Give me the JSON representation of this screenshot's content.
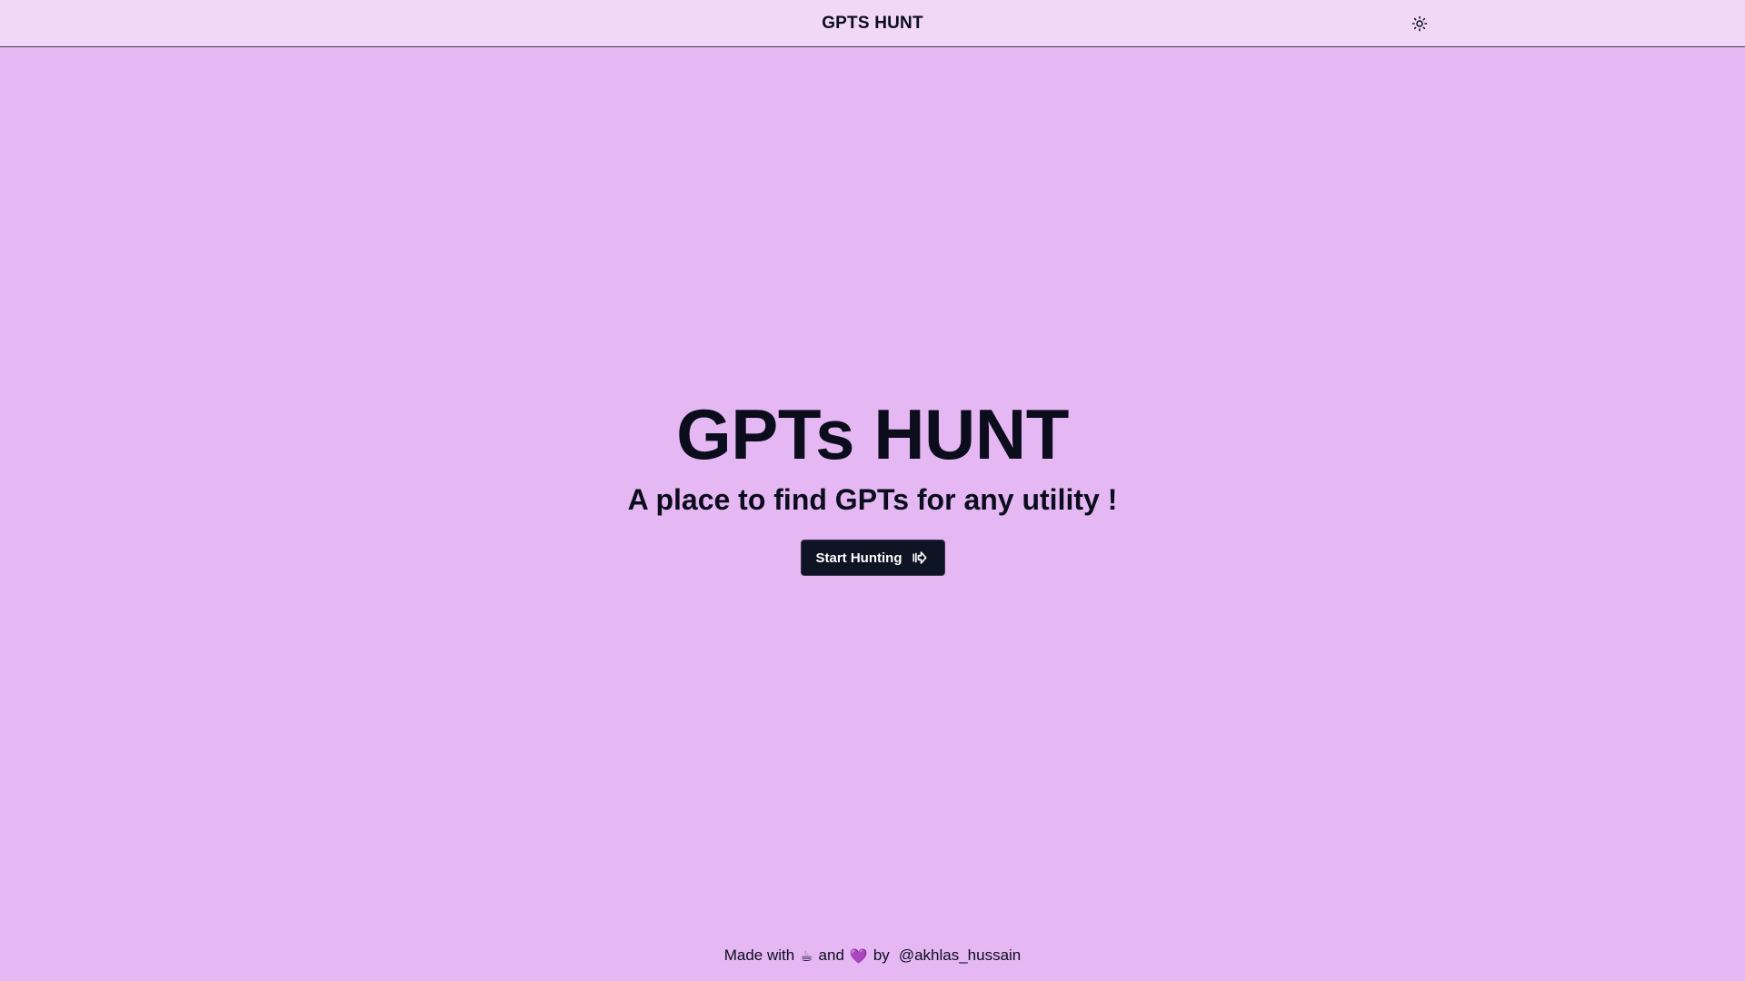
{
  "header": {
    "title": "GPTS HUNT",
    "theme_icon": "sun-icon"
  },
  "hero": {
    "title": "GPTs HUNT",
    "subtitle": "A place to find GPTs for any utility !",
    "cta_label": "Start Hunting",
    "cta_icon": "arrow-right-icon"
  },
  "footer": {
    "made_with": "Made with",
    "coffee": "☕",
    "and": "and",
    "heart": "💜",
    "by": "by",
    "author": "@akhlas_hussain"
  },
  "colors": {
    "background": "#e5b8f4",
    "header_background": "#f1d7f8",
    "button_background": "#0f1424",
    "text": "#0b0d1c"
  }
}
